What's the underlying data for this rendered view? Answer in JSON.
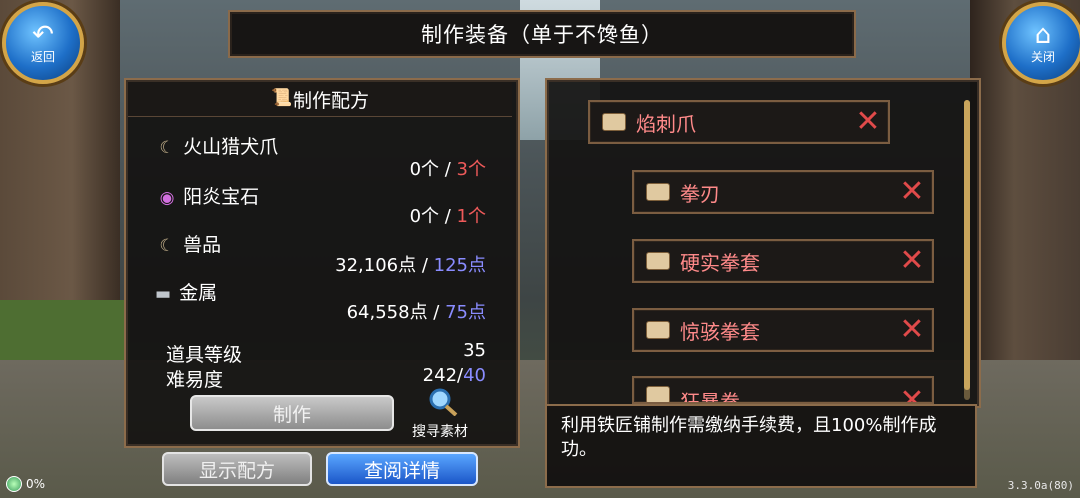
{
  "header": {
    "title": "制作装备（单于不馋鱼）",
    "back_label": "返回",
    "close_label": "关闭"
  },
  "recipe_panel": {
    "title": "制作配方",
    "materials": [
      {
        "name": "火山猎犬爪",
        "have": "0个",
        "sep": " / ",
        "need": "3个",
        "icon": "claw-icon",
        "need_color": "#ef5a5a"
      },
      {
        "name": "阳炎宝石",
        "have": "0个",
        "sep": " / ",
        "need": "1个",
        "icon": "gem-icon",
        "need_color": "#ef5a5a"
      },
      {
        "name": "兽品",
        "have": "32,106点",
        "sep": " / ",
        "need": "125点",
        "icon": "claw-icon",
        "need_color": "#8a8cff"
      },
      {
        "name": "金属",
        "have": "64,558点",
        "sep": " / ",
        "need": "75点",
        "icon": "metal-icon",
        "need_color": "#8a8cff"
      }
    ],
    "item_level_label": "道具等级",
    "item_level_value": "35",
    "difficulty_label": "难易度",
    "difficulty_current": "242/",
    "difficulty_max": "40",
    "craft_button": "制作",
    "search_label": "搜寻素材"
  },
  "bottom_buttons": {
    "show_recipe": "显示配方",
    "view_details": "查阅详情"
  },
  "recipe_tree": [
    {
      "label": "焰刺爪"
    },
    {
      "label": "拳刃"
    },
    {
      "label": "硬实拳套"
    },
    {
      "label": "惊骇拳套"
    },
    {
      "label": "狂暴拳"
    }
  ],
  "info_text": "利用铁匠铺制作需缴纳手续费，且100%制作成功。",
  "status": {
    "loading_pct": "0%",
    "version": "3.3.0a(80)"
  },
  "colors": {
    "accent_gold": "#d3a548",
    "panel_border": "#8c6c4b",
    "red_text": "#ef5a5a",
    "blue_text": "#8a8cff",
    "button_blue": "#1b56c8"
  }
}
